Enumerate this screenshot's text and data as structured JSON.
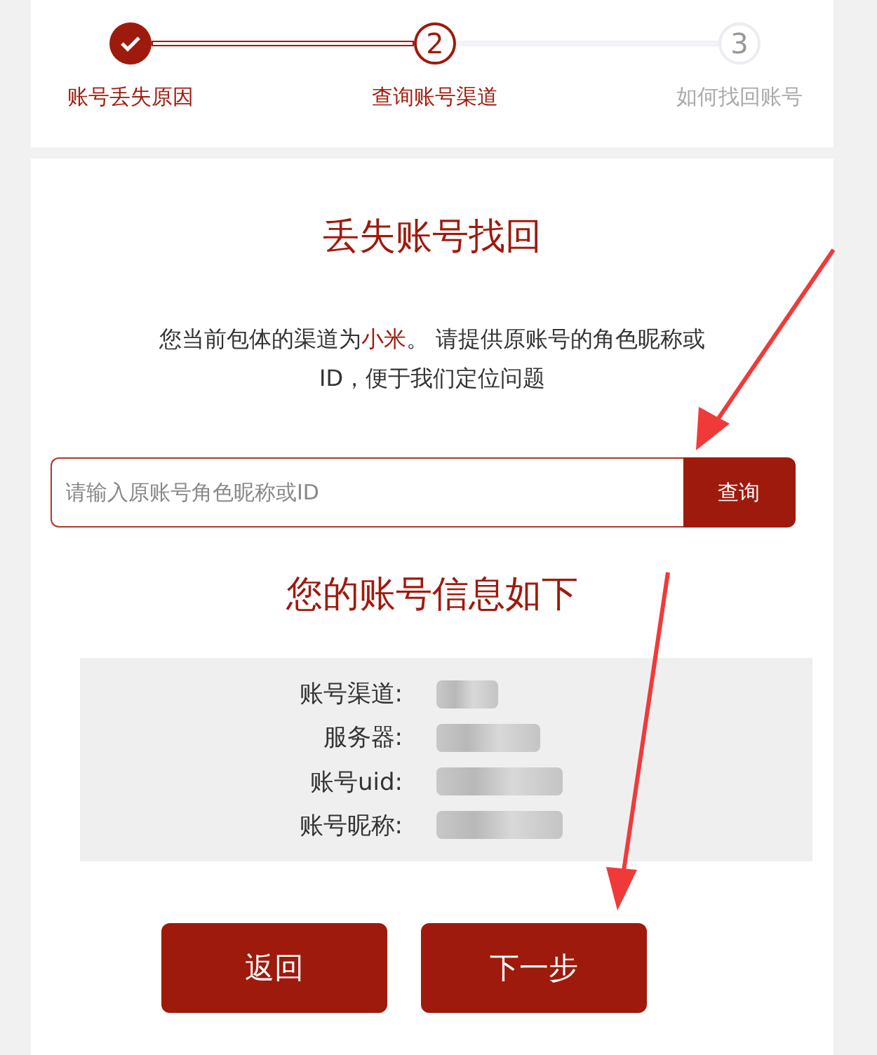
{
  "steps": [
    {
      "label": "账号丢失原因",
      "completed": true,
      "selected": false
    },
    {
      "number": "2",
      "label": "查询账号渠道",
      "completed": false,
      "selected": true
    },
    {
      "number": "3",
      "label": "如何找回账号",
      "completed": false,
      "selected": false
    }
  ],
  "title": "丢失账号找回",
  "description": [
    {
      "text": "您当前包体的渠道为",
      "highlight": false
    },
    {
      "text": "小米",
      "highlight": true
    },
    {
      "text": "。 请提供原账号的角色昵称或ID，便于我们定位问题",
      "highlight": false
    }
  ],
  "search": {
    "placeholder": "请输入原账号角色昵称或ID",
    "button": "查询"
  },
  "info_title": "您的账号信息如下",
  "info_rows": [
    {
      "label": "账号渠道:"
    },
    {
      "label": "服务器:"
    },
    {
      "label": "账号uid:"
    },
    {
      "label": "账号昵称:"
    }
  ],
  "buttons": [
    "返回",
    "下一步"
  ]
}
